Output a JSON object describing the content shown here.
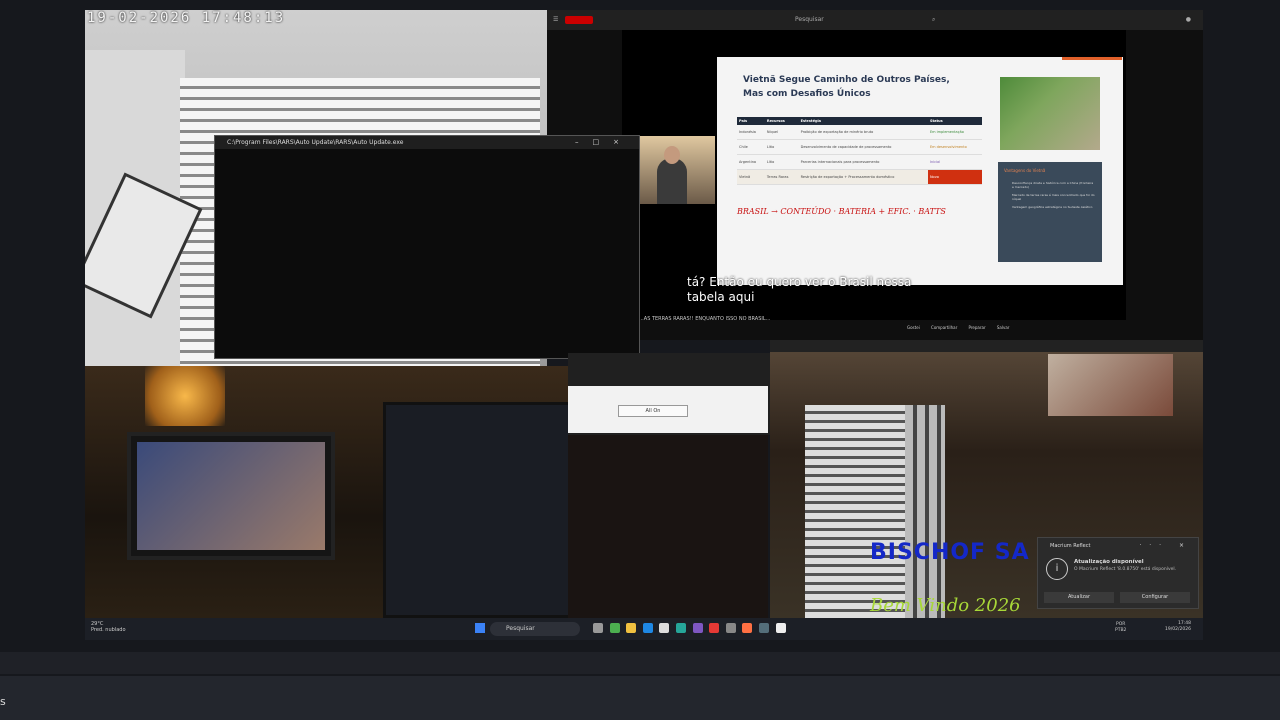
{
  "cam1": {
    "timestamp": "19-02-2026  17:48:13"
  },
  "console": {
    "title": "C:\\Program Files\\RARS\\Auto Update\\RARS\\Auto Update.exe",
    "min": "–",
    "max": "□",
    "close": "×"
  },
  "youtube": {
    "search_placeholder": "Pesquisar",
    "slide_title": "Vietnã Segue Caminho de Outros Países, Mas com Desafios Únicos",
    "table_headers": [
      "País",
      "Recursos",
      "Estratégia",
      "Status"
    ],
    "table_rows": [
      [
        "Indonésia",
        "Níquel",
        "Proibição de exportação de minério bruto",
        "Em implementação"
      ],
      [
        "Chile",
        "Lítio",
        "Desenvolvimento de capacidade de processamento",
        "Em desenvolvimento"
      ],
      [
        "Argentina",
        "Lítio",
        "Parcerias internacionais para processamento",
        "Inicial"
      ],
      [
        "Vietnã",
        "Terras Raras",
        "Restrição de exportação + Processamento doméstico",
        "Novo"
      ]
    ],
    "side_heading": "Vantagens do Vietnã",
    "side_items": [
      "Desconfiança direta e histórica com a China (fronteira e mercado)",
      "Mercado de terras raras é mais concentrado que foi do níquel",
      "Vantagem geográfica estratégica no Sudeste Asiático"
    ],
    "annotation": "BRASIL → CONTEÚDO · BATERIA + EFIC. · BATTS",
    "caption_line1": "tá? Então eu quero ver o Brasil nessa",
    "caption_line2": "tabela aqui",
    "ticker": "...AS TERRAS RARAS!! ENQUANTO ISSO NO BRASIL...",
    "actions": "Gostei Compartilhar Preparar Salvar"
  },
  "mid": {
    "button": "All On"
  },
  "cam3": {
    "overlay1": "BISCHOF SA",
    "overlay2": "Bem Vindo 2026"
  },
  "notification": {
    "app": "Macrium Reflect",
    "title": "Atualização disponível",
    "body": "O Macrium Reflect '8.0.8750' está disponível.",
    "button1": "Atualizar",
    "button2": "Configurar",
    "controls": "··· ×"
  },
  "taskbar": {
    "temp": "29°C",
    "weather": "Pred. nublado",
    "search": "Pesquisar",
    "tray_lang": "POR",
    "tray_layout": "PTB2",
    "time": "17:48",
    "date": "19/02/2026"
  },
  "bottom": {
    "partial": "s"
  }
}
